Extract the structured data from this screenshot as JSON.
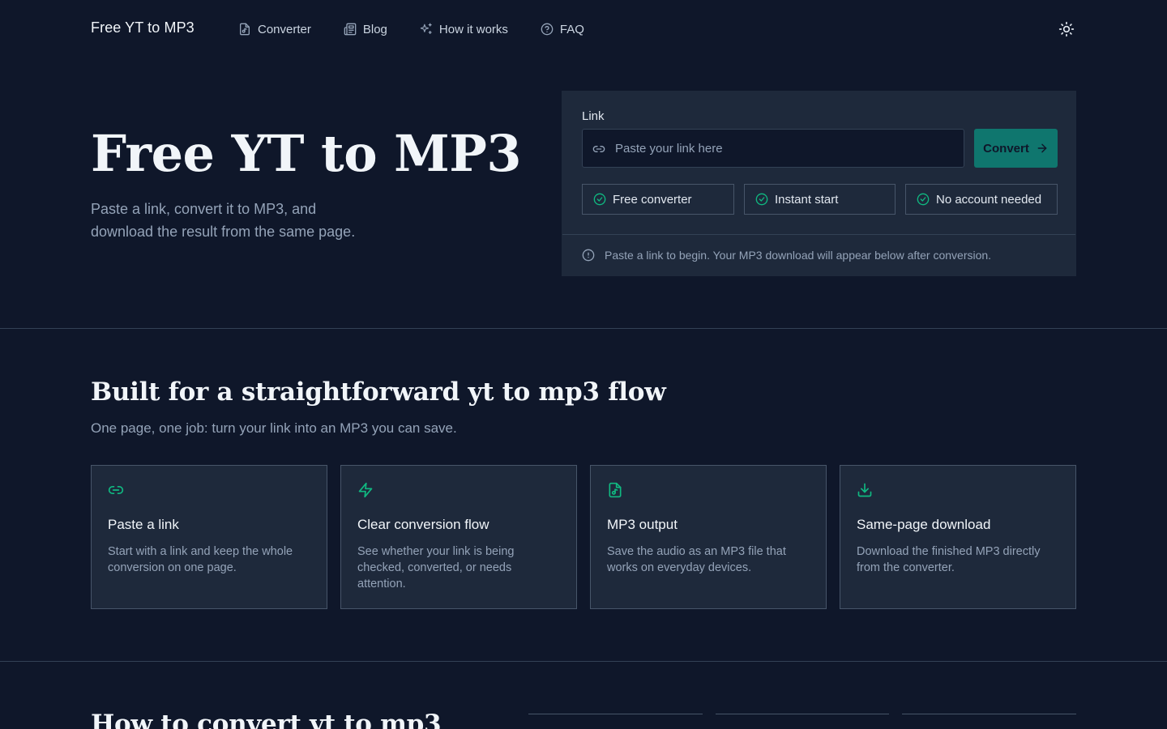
{
  "header": {
    "brand": "Free YT to MP3",
    "nav": [
      {
        "label": "Converter",
        "icon": "file-audio-icon"
      },
      {
        "label": "Blog",
        "icon": "newspaper-icon"
      },
      {
        "label": "How it works",
        "icon": "sparkles-icon"
      },
      {
        "label": "FAQ",
        "icon": "help-circle-icon"
      }
    ],
    "theme_toggle_icon": "sun-icon"
  },
  "hero": {
    "title": "Free YT to MP3",
    "subtitle": "Paste a link, convert it to MP3, and download the result from the same page."
  },
  "converter": {
    "label": "Link",
    "input_placeholder": "Paste your link here",
    "input_value": "",
    "convert_label": "Convert",
    "chips": [
      "Free converter",
      "Instant start",
      "No account needed"
    ],
    "status": "Paste a link to begin. Your MP3 download will appear below after conversion."
  },
  "features": {
    "title": "Built for a straightforward yt to mp3 flow",
    "subtitle": "One page, one job: turn your link into an MP3 you can save.",
    "cards": [
      {
        "icon": "link-icon",
        "title": "Paste a link",
        "body": "Start with a link and keep the whole conversion on one page."
      },
      {
        "icon": "zap-icon",
        "title": "Clear conversion flow",
        "body": "See whether your link is being checked, converted, or needs attention."
      },
      {
        "icon": "file-audio-icon",
        "title": "MP3 output",
        "body": "Save the audio as an MP3 file that works on everyday devices."
      },
      {
        "icon": "download-icon",
        "title": "Same-page download",
        "body": "Download the finished MP3 directly from the converter."
      }
    ]
  },
  "how": {
    "title": "How to convert yt to mp3"
  },
  "colors": {
    "background": "#0f172a",
    "panel": "#1e293b",
    "accent": "#10b981",
    "button": "#0f766e"
  }
}
